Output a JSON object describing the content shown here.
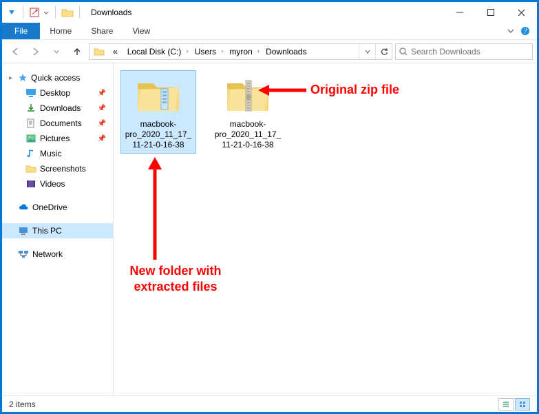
{
  "window": {
    "title": "Downloads"
  },
  "menubar": {
    "file": "File",
    "home": "Home",
    "share": "Share",
    "view": "View"
  },
  "breadcrumb": {
    "parts": [
      "Local Disk (C:)",
      "Users",
      "myron",
      "Downloads"
    ]
  },
  "search": {
    "placeholder": "Search Downloads"
  },
  "nav": {
    "quick_access": "Quick access",
    "items": [
      {
        "label": "Desktop",
        "pinned": true
      },
      {
        "label": "Downloads",
        "pinned": true
      },
      {
        "label": "Documents",
        "pinned": true
      },
      {
        "label": "Pictures",
        "pinned": true
      },
      {
        "label": "Music",
        "pinned": false
      },
      {
        "label": "Screenshots",
        "pinned": false
      },
      {
        "label": "Videos",
        "pinned": false
      }
    ],
    "onedrive": "OneDrive",
    "this_pc": "This PC",
    "network": "Network"
  },
  "files": {
    "folder_name": "macbook-pro_2020_11_17_11-21-0-16-38",
    "zip_name": "macbook-pro_2020_11_17_11-21-0-16-38"
  },
  "annotations": {
    "zip_label": "Original zip file",
    "folder_label_line1": "New folder with",
    "folder_label_line2": "extracted files"
  },
  "status": {
    "count": "2 items"
  }
}
